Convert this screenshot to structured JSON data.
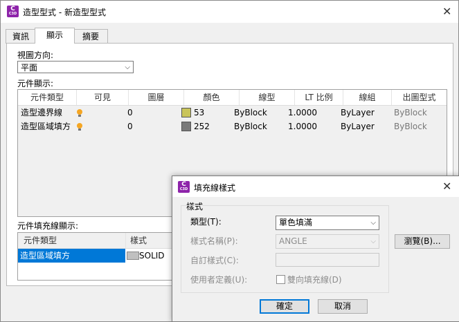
{
  "window": {
    "title": "造型型式 - 新造型型式",
    "app_icon_letter": "C",
    "app_icon_sub": "C3D"
  },
  "tabs": [
    {
      "label": "資訊"
    },
    {
      "label": "顯示"
    },
    {
      "label": "摘要"
    }
  ],
  "view_direction": {
    "label": "視圖方向:",
    "value": "平面"
  },
  "component_display": {
    "label": "元件顯示:",
    "columns": [
      "元件類型",
      "可見",
      "圖層",
      "顏色",
      "線型",
      "LT 比例",
      "線組",
      "出圖型式"
    ],
    "rows": [
      {
        "type": "造型邊界線",
        "layer": "0",
        "color": "53",
        "color_hex": "#c9c45a",
        "linetype": "ByBlock",
        "lt_scale": "1.0000",
        "lineweight": "ByLayer",
        "plot_style": "ByBlock"
      },
      {
        "type": "造型區域填方",
        "layer": "0",
        "color": "252",
        "color_hex": "#7a7a7a",
        "linetype": "ByBlock",
        "lt_scale": "1.0000",
        "lineweight": "ByLayer",
        "plot_style": "ByBlock"
      }
    ]
  },
  "hatch_display": {
    "label": "元件填充線顯示:",
    "columns": [
      "元件類型",
      "樣式"
    ],
    "rows": [
      {
        "type": "造型區域填方",
        "pattern": "SOLID"
      }
    ]
  },
  "hatch_dialog": {
    "title": "填充線樣式",
    "group_label": "樣式",
    "type_label": "類型(T):",
    "type_value": "單色填滿",
    "pattern_name_label": "樣式名稱(P):",
    "pattern_name_value": "ANGLE",
    "custom_pattern_label": "自訂樣式(C):",
    "custom_pattern_value": "",
    "user_defined_label": "使用者定義(U):",
    "double_hatch_label": "雙向填充線(D)",
    "browse_label": "瀏覽(B)...",
    "ok_label": "確定",
    "cancel_label": "取消"
  },
  "colors": {
    "selection": "#0078d7",
    "bulb": "#f5a623",
    "app_icon": "#8e24aa"
  }
}
